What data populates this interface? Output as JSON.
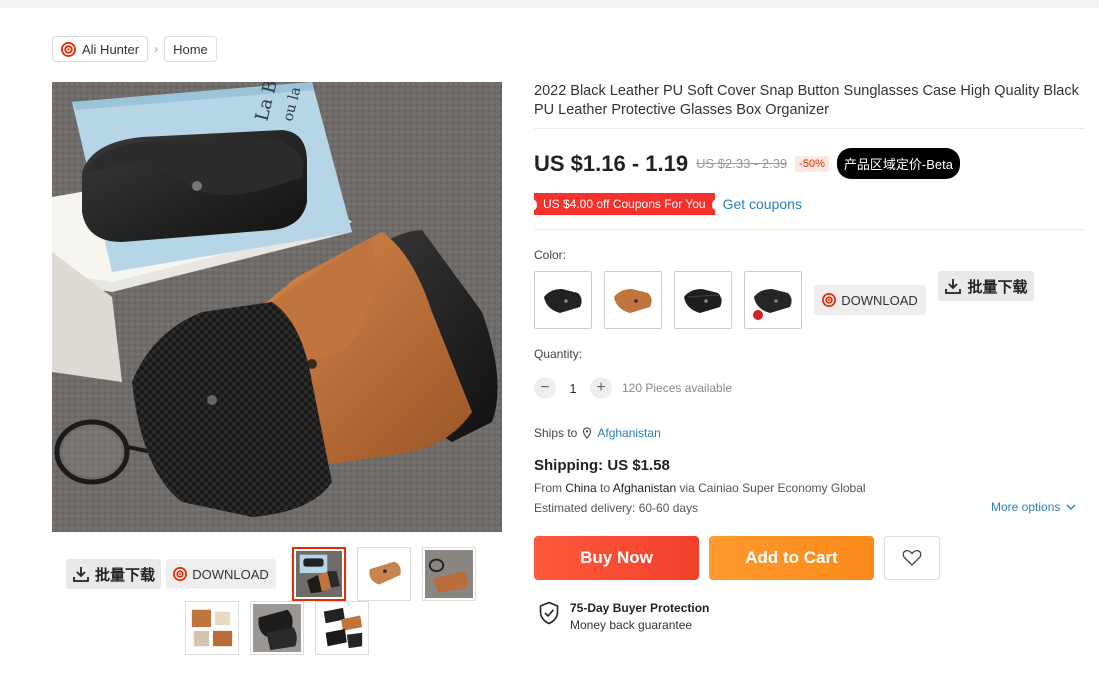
{
  "breadcrumb": {
    "items": [
      "Ali Hunter",
      "Home"
    ],
    "separator": "›"
  },
  "product": {
    "title": "2022 Black Leather PU Soft Cover Snap Button Sunglasses Case High Quality Black PU Leather Protective Glasses Box Organizer",
    "price": "US $1.16 - 1.19",
    "old_price": "US $2.33 - 2.39",
    "discount": "-50%",
    "beta_badge": "产品区域定价-Beta",
    "coupon_label": "US $4.00 off Coupons For You",
    "coupon_link": "Get coupons"
  },
  "tools": {
    "download_label": "DOWNLOAD",
    "bulk_label": "批量下载"
  },
  "color": {
    "label": "Color:",
    "swatches": [
      {
        "name": "black",
        "color": "#222222"
      },
      {
        "name": "brown",
        "color": "#c0743e"
      },
      {
        "name": "black-carbon",
        "color": "#1e1e1e"
      },
      {
        "name": "black-red",
        "color": "#262626"
      }
    ]
  },
  "quantity": {
    "label": "Quantity:",
    "value": "1",
    "minus": "−",
    "plus": "+",
    "available": "120 Pieces available"
  },
  "shipping": {
    "ships_to_label": "Ships to",
    "ships_to_country": "Afghanistan",
    "title": "Shipping: US $1.58",
    "route_from_label": "From",
    "route_from": "China",
    "route_to_label": "to",
    "route_to": "Afghanistan",
    "route_via": "via Cainiao Super Economy Global",
    "estimated": "Estimated delivery: 60-60 days",
    "more_options": "More options"
  },
  "actions": {
    "buy_now": "Buy Now",
    "add_to_cart": "Add to Cart"
  },
  "protection": {
    "title": "75-Day Buyer Protection",
    "subtitle": "Money back guarantee"
  },
  "colors": {
    "accent": "#e62e04",
    "link": "#2a7fbd",
    "buy": "#f1402a",
    "cart": "#f98a1a"
  }
}
